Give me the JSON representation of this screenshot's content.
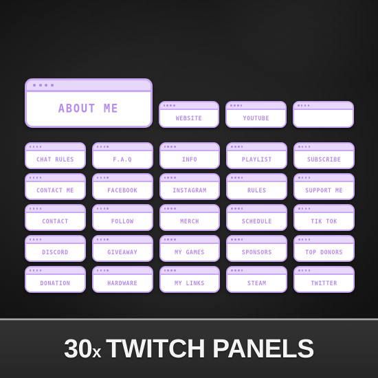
{
  "background": {
    "base_color": "#1e1e1e",
    "accent_color": "#b78cf0",
    "panel_border_color": "#c9a9f5",
    "panel_titlebar_color": "#e6d7fb",
    "panel_body_color": "#ffffff"
  },
  "featured_panel": {
    "label": "ABOUT ME",
    "dots": 4
  },
  "rows": [
    {
      "id": "row-0",
      "panels": [
        {
          "label": "WEBSITE"
        },
        {
          "label": "YOUTUBE"
        },
        {
          "label": ""
        }
      ]
    },
    {
      "id": "row-1",
      "panels": [
        {
          "label": "CHAT RULES"
        },
        {
          "label": "F.A.Q"
        },
        {
          "label": "INFO"
        },
        {
          "label": "PLAYLIST"
        },
        {
          "label": "SUBSCRIBE"
        }
      ]
    },
    {
      "id": "row-2",
      "panels": [
        {
          "label": "CONTACT ME"
        },
        {
          "label": "FACEBOOK"
        },
        {
          "label": "INSTAGRAM"
        },
        {
          "label": "RULES"
        },
        {
          "label": "SUPPORT ME"
        }
      ]
    },
    {
      "id": "row-3",
      "panels": [
        {
          "label": "CONTACT"
        },
        {
          "label": "FOLLOW"
        },
        {
          "label": "MERCH"
        },
        {
          "label": "SCHEDULE"
        },
        {
          "label": "TIK TOK"
        }
      ]
    },
    {
      "id": "row-4",
      "panels": [
        {
          "label": "DISCORD"
        },
        {
          "label": "GIVEAWAY"
        },
        {
          "label": "MY GAMES"
        },
        {
          "label": "SPONSORS"
        },
        {
          "label": "TOP DONORS"
        }
      ]
    },
    {
      "id": "row-5",
      "panels": [
        {
          "label": "DONATION"
        },
        {
          "label": "HARDWARE"
        },
        {
          "label": "MY LINKS"
        },
        {
          "label": "STEAM"
        },
        {
          "label": "TWITTER"
        }
      ]
    }
  ],
  "banner": {
    "count": "30",
    "multiplier": "x",
    "text": " TWITCH PANELS"
  }
}
